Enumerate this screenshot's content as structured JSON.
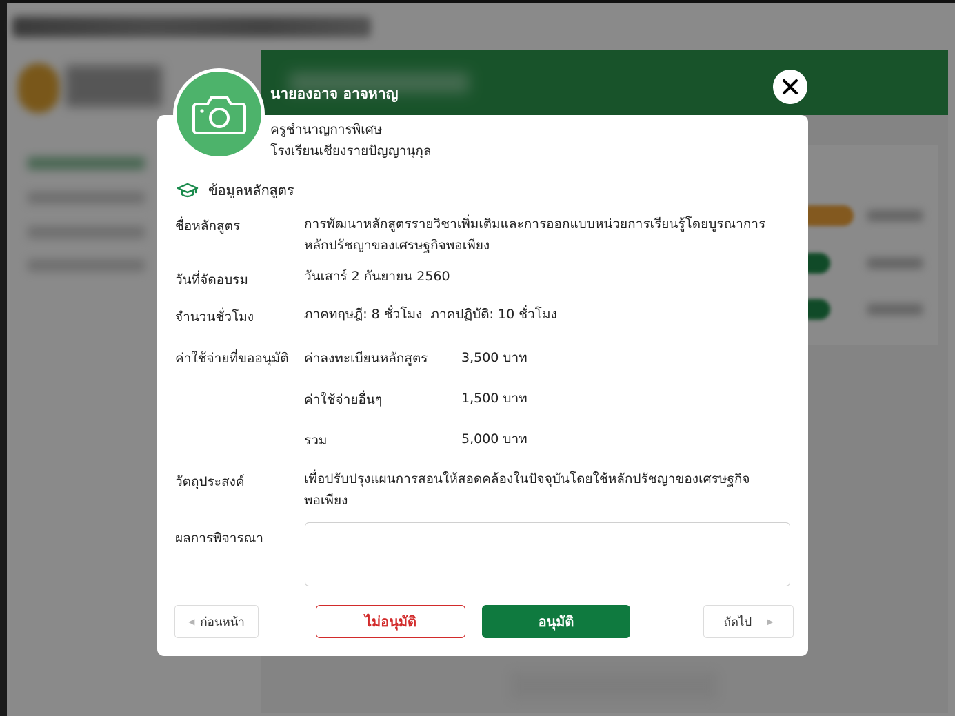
{
  "teacher": {
    "name": "นายองอาจ อาจหาญ",
    "position": "ครูชำนาญการพิเศษ",
    "school": "โรงเรียนเชียงรายปัญญานุกุล"
  },
  "section": {
    "title": "ข้อมูลหลักสูตร",
    "icon": "graduation-cap-icon"
  },
  "course": {
    "name_label": "ชื่อหลักสูตร",
    "name_line1": "การพัฒนาหลักสูตรรายวิชาเพิ่มเติมและการออกแบบหน่วยการเรียนรู้โดยบูรณาการ",
    "name_line2": "หลักปรัชญาของเศรษฐกิจพอเพียง",
    "date_label": "วันที่จัดอบรม",
    "date_value": "วันเสาร์ 2 กันยายน 2560",
    "hours_label": "จำนวนชั่วโมง",
    "hours_value": "ภาคทฤษฎี: 8 ชั่วโมง  ภาคปฏิบัติ: 10 ชั่วโมง",
    "cost_label": "ค่าใช้จ่ายที่ขออนุมัติ",
    "costs": [
      {
        "label": "ค่าลงทะเบียนหลักสูตร",
        "value": "3,500 บาท"
      },
      {
        "label": "ค่าใช้จ่ายอื่นๆ",
        "value": "1,500 บาท"
      },
      {
        "label": "รวม",
        "value": "5,000 บาท"
      }
    ],
    "objective_label": "วัตถุประสงค์",
    "objective_line1": "เพื่อปรับปรุงแผนการสอนให้สอดคล้องในปัจจุบันโดยใช้หลักปรัชญาของเศรษฐกิจ",
    "objective_line2": "พอเพียง",
    "result_label": "ผลการพิจารณา",
    "result_value": ""
  },
  "buttons": {
    "prev": "ก่อนหน้า",
    "reject": "ไม่อนุมัติ",
    "approve": "อนุมัติ",
    "next": "ถัดไป"
  },
  "colors": {
    "accent": "#4db36b",
    "approve": "#0f7a3f",
    "reject": "#d22b2b"
  }
}
